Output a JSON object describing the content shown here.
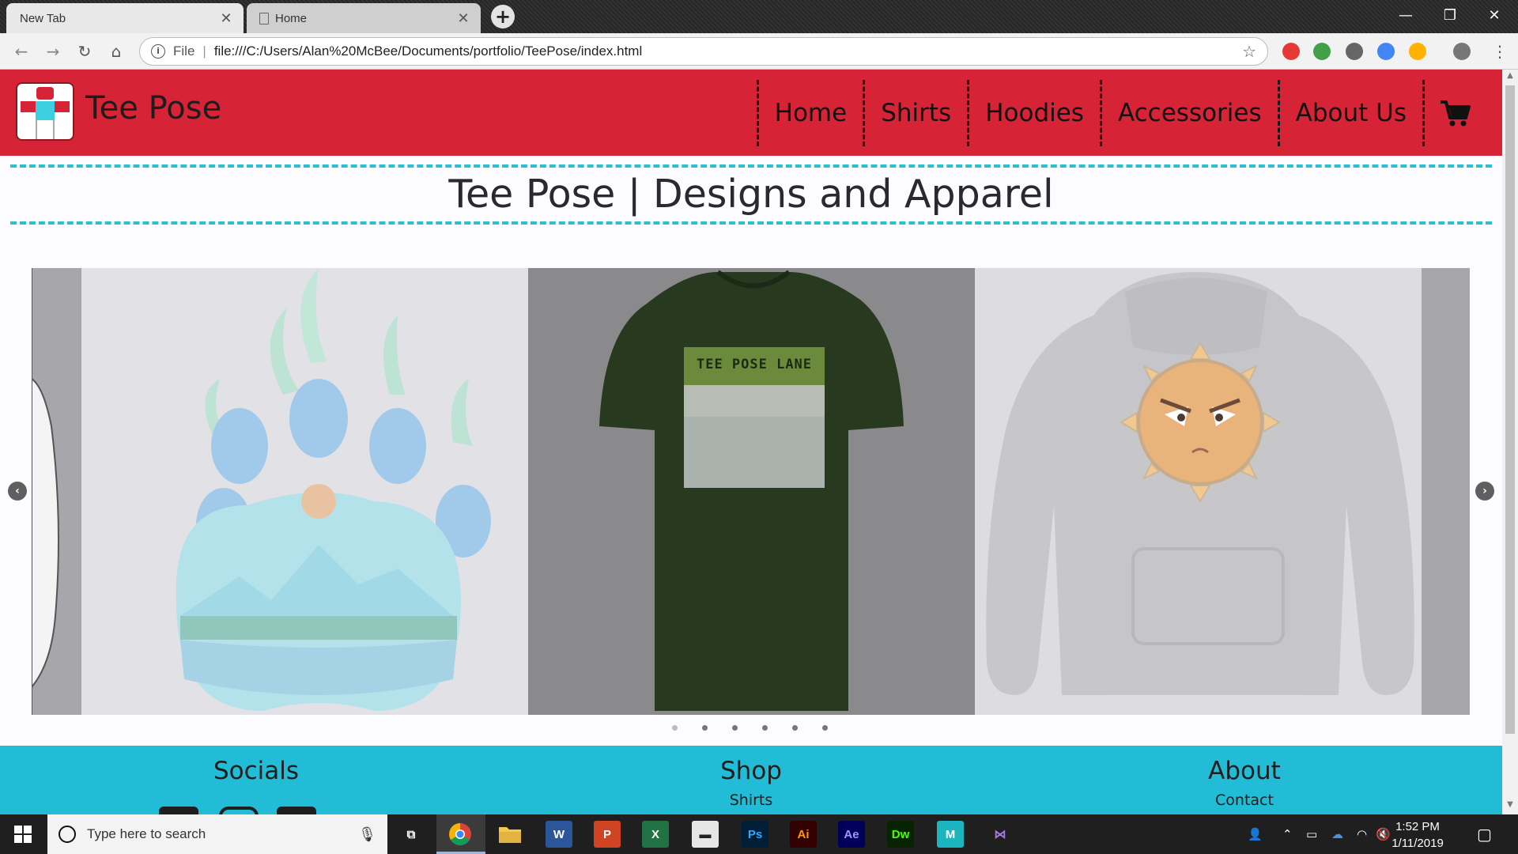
{
  "browser": {
    "tabs": [
      {
        "label": "New Tab",
        "close": "✕"
      },
      {
        "label": "Home",
        "close": "✕"
      }
    ],
    "new_tab_glyph": "+",
    "window_controls": {
      "minimize": "—",
      "maximize": "❐",
      "close": "✕"
    },
    "nav": {
      "back": "←",
      "forward": "→",
      "reload": "↻",
      "home": "⌂"
    },
    "address": {
      "info_glyph": "i",
      "scheme_label": "File",
      "separator": "|",
      "url": "file:///C:/Users/Alan%20McBee/Documents/portfolio/TeePose/index.html",
      "star": "☆"
    },
    "extensions": [
      {
        "name": "opera-icon",
        "color": "#e53935"
      },
      {
        "name": "color-wheel-icon",
        "color": "#43a047"
      },
      {
        "name": "wordpress-icon",
        "color": "#666666"
      },
      {
        "name": "drive-icon",
        "color": "#4285f4"
      },
      {
        "name": "orange-extension-icon",
        "color": "#ffb300"
      },
      {
        "name": "profile-avatar-icon",
        "color": "#777777"
      }
    ],
    "menu_glyph": "⋮"
  },
  "site": {
    "brand": "Tee Pose",
    "nav": [
      "Home",
      "Shirts",
      "Hoodies",
      "Accessories",
      "About Us"
    ],
    "cart_icon": "cart-icon",
    "hero_title": "Tee Pose | Designs and Apparel",
    "carousel": {
      "prev_glyph": "‹",
      "next_glyph": "›",
      "slides": [
        {
          "name": "paw-print-mountain-design"
        },
        {
          "name": "tee-pose-lane-shirt",
          "shirt_text": "TEE POSE LANE"
        },
        {
          "name": "angry-sun-hoodie"
        }
      ],
      "dot_count": 6,
      "active_dot": 0
    },
    "footer": {
      "socials": {
        "heading": "Socials"
      },
      "shop": {
        "heading": "Shop",
        "link": "Shirts"
      },
      "about": {
        "heading": "About",
        "link": "Contact"
      }
    }
  },
  "colors": {
    "header_red": "#d62436",
    "accent_teal": "#2cbfd0",
    "footer_teal": "#23bcd6"
  },
  "taskbar": {
    "search_placeholder": "Type here to search",
    "apps": [
      {
        "name": "task-view-icon",
        "label": "⧉",
        "bg": "transparent",
        "fg": "#ffffff"
      },
      {
        "name": "chrome-icon",
        "label": "",
        "bg": "transparent",
        "fg": "#ffffff"
      },
      {
        "name": "file-explorer-icon",
        "label": "",
        "bg": "#f2c94c",
        "fg": "#333333"
      },
      {
        "name": "word-icon",
        "label": "W",
        "bg": "#2b579a",
        "fg": "#ffffff"
      },
      {
        "name": "powerpoint-icon",
        "label": "P",
        "bg": "#d04423",
        "fg": "#ffffff"
      },
      {
        "name": "excel-icon",
        "label": "X",
        "bg": "#217346",
        "fg": "#ffffff"
      },
      {
        "name": "terminal-icon",
        "label": "▬",
        "bg": "#e6e6e6",
        "fg": "#222222"
      },
      {
        "name": "photoshop-icon",
        "label": "Ps",
        "bg": "#001e36",
        "fg": "#31a8ff"
      },
      {
        "name": "illustrator-icon",
        "label": "Ai",
        "bg": "#330000",
        "fg": "#ff9a00"
      },
      {
        "name": "after-effects-icon",
        "label": "Ae",
        "bg": "#00005b",
        "fg": "#9999ff"
      },
      {
        "name": "dreamweaver-icon",
        "label": "Dw",
        "bg": "#072401",
        "fg": "#4aff00"
      },
      {
        "name": "maya-icon",
        "label": "M",
        "bg": "#1bb5c0",
        "fg": "#ffffff"
      },
      {
        "name": "visual-studio-icon",
        "label": "⋈",
        "bg": "transparent",
        "fg": "#a47bd9"
      }
    ],
    "clock": {
      "time": "1:52 PM",
      "date": "1/11/2019"
    }
  }
}
